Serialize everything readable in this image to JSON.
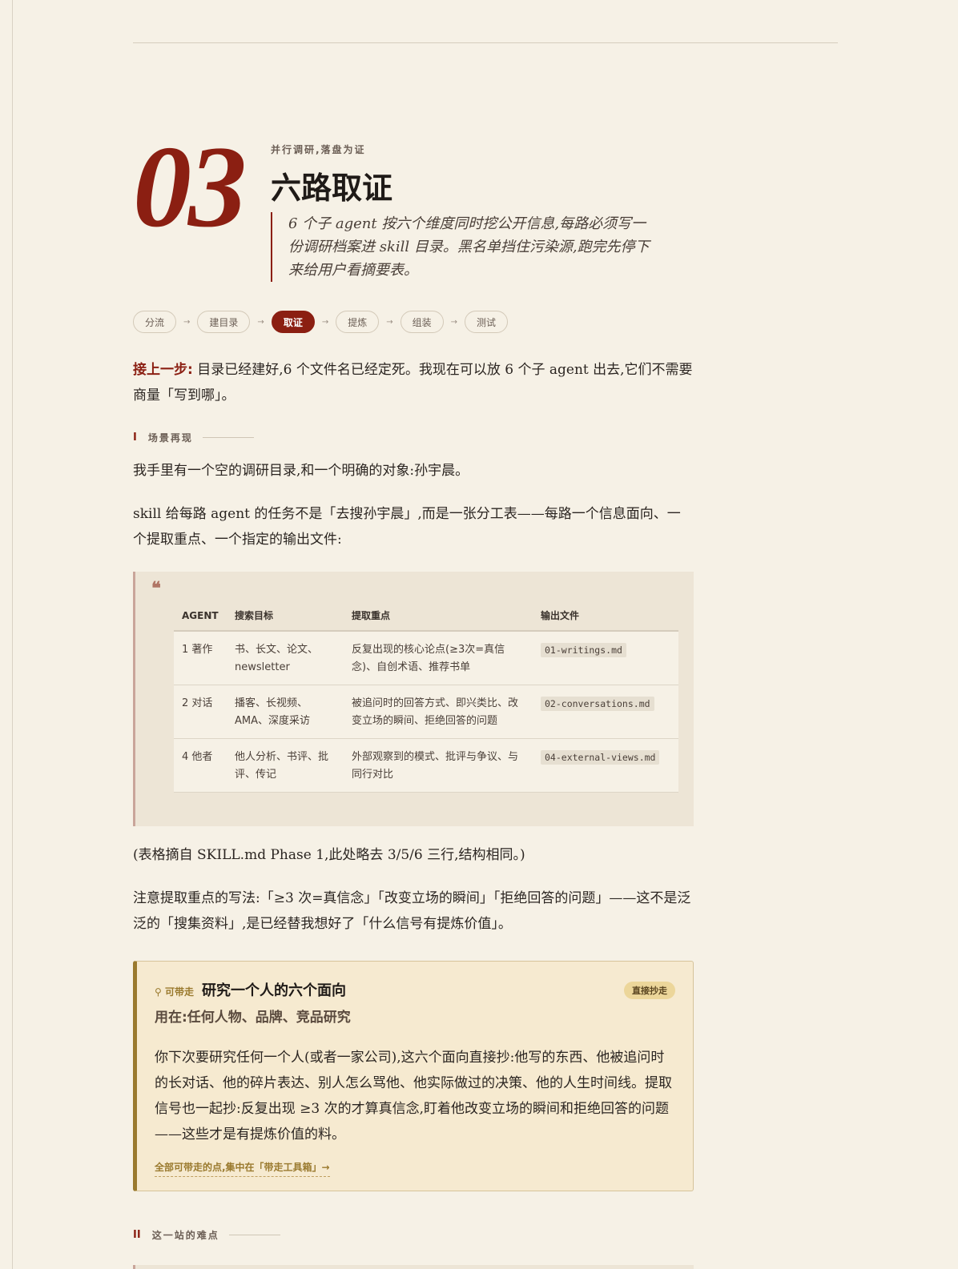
{
  "chapter": {
    "number": "03",
    "kicker": "并行调研,落盘为证",
    "title": "六路取证",
    "lede": "6 个子 agent 按六个维度同时挖公开信息,每路必须写一份调研档案进 skill 目录。黑名单挡住污染源,跑完先停下来给用户看摘要表。"
  },
  "steps": [
    "分流",
    "建目录",
    "取证",
    "提炼",
    "组装",
    "测试"
  ],
  "steps_active": "取证",
  "step_arrow": "→",
  "recap": {
    "lead": "接上一步:",
    "text": " 目录已经建好,6 个文件名已经定死。我现在可以放 6 个子 agent 出去,它们不需要商量「写到哪」。"
  },
  "section1": {
    "roman": "I",
    "title": "场景再现"
  },
  "p1": "我手里有一个空的调研目录,和一个明确的对象:孙宇晨。",
  "p2": "skill 给每路 agent 的任务不是「去搜孙宇晨」,而是一张分工表——每路一个信息面向、一个提取重点、一个指定的输出文件:",
  "quote_mark": "❝",
  "table": {
    "headers": [
      "AGENT",
      "搜索目标",
      "提取重点",
      "输出文件"
    ],
    "rows": [
      [
        "1 著作",
        "书、长文、论文、newsletter",
        "反复出现的核心论点(≥3次=真信念)、自创术语、推荐书单",
        "01-writings.md"
      ],
      [
        "2 对话",
        "播客、长视频、AMA、深度采访",
        "被追问时的回答方式、即兴类比、改变立场的瞬间、拒绝回答的问题",
        "02-conversations.md"
      ],
      [
        "4 他者",
        "他人分析、书评、批评、传记",
        "外部观察到的模式、批评与争议、与同行对比",
        "04-external-views.md"
      ]
    ]
  },
  "p3": "(表格摘自 SKILL.md Phase 1,此处略去 3/5/6 三行,结构相同。)",
  "p4": "注意提取重点的写法:「≥3 次=真信念」「改变立场的瞬间」「拒绝回答的问题」——这不是泛泛的「搜集资料」,是已经替我想好了「什么信号有提炼价值」。",
  "takeaway": {
    "tag": "可带走",
    "title": "研究一个人的六个面向",
    "badge": "直接抄走",
    "subtitle": "用在:任何人物、品牌、竞品研究",
    "body": "你下次要研究任何一个人(或者一家公司),这六个面向直接抄:他写的东西、他被追问时的长对话、他的碎片表达、别人怎么骂他、他实际做过的决策、他的人生时间线。提取信号也一起抄:反复出现 ≥3 次的才算真信念,盯着他改变立场的瞬间和拒绝回答的问题——这些才是有提炼价值的料。",
    "link": "全部可带走的点,集中在「带走工具箱」→"
  },
  "section2": {
    "roman": "II",
    "title": "这一站的难点"
  },
  "colors": {
    "accent": "#8b1f12",
    "gold": "#9a7a2e",
    "paper": "#f6f1e6"
  }
}
